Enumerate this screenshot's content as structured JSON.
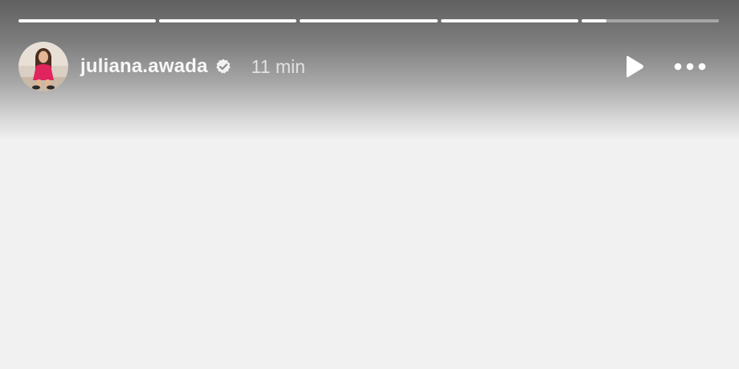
{
  "story": {
    "segments": [
      {
        "progress": 1.0
      },
      {
        "progress": 1.0
      },
      {
        "progress": 1.0
      },
      {
        "progress": 1.0
      },
      {
        "progress": 0.18
      }
    ],
    "user": {
      "username": "juliana.awada",
      "verified": true,
      "time_ago": "11 min"
    },
    "controls": {
      "play_icon": "play-icon",
      "more_icon": "more-horizontal-icon"
    }
  },
  "colors": {
    "progress_fill": "#ffffff",
    "progress_track": "rgba(255,255,255,0.38)",
    "avatar_outfit": "#e0245e",
    "background": "#f1f1f1"
  }
}
